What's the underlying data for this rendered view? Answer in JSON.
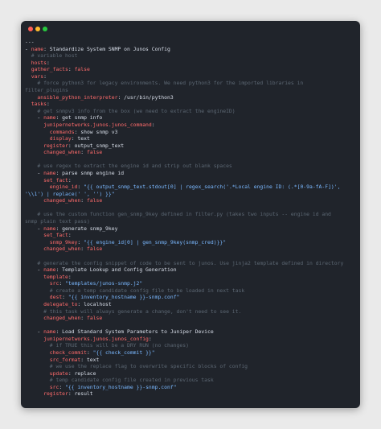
{
  "window": {
    "controls": [
      "close",
      "minimize",
      "maximize"
    ]
  },
  "colors": {
    "background": "#eaeaea",
    "editor_background": "#20242b",
    "key": "#ff6b6b",
    "string": "#7ab8ff",
    "comment": "#5c6773",
    "text": "#d8dee9",
    "close": "#ff5f56",
    "minimize": "#ffbd2e",
    "maximize": "#27c93f"
  },
  "code": {
    "lines": [
      [
        {
          "t": "---",
          "c": "plain"
        }
      ],
      [
        {
          "t": "- ",
          "c": "plain"
        },
        {
          "t": "name",
          "c": "key"
        },
        {
          "t": ": Standardize System SNMP on Junos Config",
          "c": "plain"
        }
      ],
      [
        {
          "t": "  # variable host",
          "c": "comment"
        }
      ],
      [
        {
          "t": "  ",
          "c": "plain"
        },
        {
          "t": "hosts",
          "c": "key"
        },
        {
          "t": ":",
          "c": "plain"
        }
      ],
      [
        {
          "t": "  ",
          "c": "plain"
        },
        {
          "t": "gather_facts",
          "c": "key"
        },
        {
          "t": ": ",
          "c": "plain"
        },
        {
          "t": "false",
          "c": "bool"
        }
      ],
      [
        {
          "t": "  ",
          "c": "plain"
        },
        {
          "t": "vars",
          "c": "key"
        },
        {
          "t": ":",
          "c": "plain"
        }
      ],
      [
        {
          "t": "    # force python3 for legacy environments. We need python3 for the imported libraries in",
          "c": "comment"
        }
      ],
      [
        {
          "t": "filter_plugins",
          "c": "comment"
        }
      ],
      [
        {
          "t": "    ",
          "c": "plain"
        },
        {
          "t": "ansible_python_interpreter",
          "c": "key"
        },
        {
          "t": ": /usr/bin/python3",
          "c": "plain"
        }
      ],
      [
        {
          "t": "  ",
          "c": "plain"
        },
        {
          "t": "tasks",
          "c": "key"
        },
        {
          "t": ":",
          "c": "plain"
        }
      ],
      [
        {
          "t": "    # get snmpv3 info from the box (we need to extract the engineID)",
          "c": "comment"
        }
      ],
      [
        {
          "t": "    - ",
          "c": "plain"
        },
        {
          "t": "name",
          "c": "key"
        },
        {
          "t": ": get snmp info",
          "c": "plain"
        }
      ],
      [
        {
          "t": "      ",
          "c": "plain"
        },
        {
          "t": "junipernetworks.junos.junos_command",
          "c": "key"
        },
        {
          "t": ":",
          "c": "plain"
        }
      ],
      [
        {
          "t": "        ",
          "c": "plain"
        },
        {
          "t": "commands",
          "c": "key"
        },
        {
          "t": ": show snmp v3",
          "c": "plain"
        }
      ],
      [
        {
          "t": "        ",
          "c": "plain"
        },
        {
          "t": "display",
          "c": "key"
        },
        {
          "t": ": text",
          "c": "plain"
        }
      ],
      [
        {
          "t": "      ",
          "c": "plain"
        },
        {
          "t": "register",
          "c": "key"
        },
        {
          "t": ": output_snmp_text",
          "c": "plain"
        }
      ],
      [
        {
          "t": "      ",
          "c": "plain"
        },
        {
          "t": "changed_when",
          "c": "key"
        },
        {
          "t": ": ",
          "c": "plain"
        },
        {
          "t": "false",
          "c": "bool"
        }
      ],
      [
        {
          "t": "",
          "c": "plain"
        }
      ],
      [
        {
          "t": "    # use regex to extract the engine id and strip out blank spaces",
          "c": "comment"
        }
      ],
      [
        {
          "t": "    - ",
          "c": "plain"
        },
        {
          "t": "name",
          "c": "key"
        },
        {
          "t": ": parse snmp engine id",
          "c": "plain"
        }
      ],
      [
        {
          "t": "      ",
          "c": "plain"
        },
        {
          "t": "set_fact",
          "c": "key"
        },
        {
          "t": ":",
          "c": "plain"
        }
      ],
      [
        {
          "t": "        ",
          "c": "plain"
        },
        {
          "t": "engine_id",
          "c": "key"
        },
        {
          "t": ": ",
          "c": "plain"
        },
        {
          "t": "\"{{ output_snmp_text.stdout[0] | regex_search('.*Local engine ID: (.*[0-9a-fA-F])',",
          "c": "str"
        }
      ],
      [
        {
          "t": "'\\\\1') | replace(' ', '') }}\"",
          "c": "str"
        }
      ],
      [
        {
          "t": "      ",
          "c": "plain"
        },
        {
          "t": "changed_when",
          "c": "key"
        },
        {
          "t": ": ",
          "c": "plain"
        },
        {
          "t": "false",
          "c": "bool"
        }
      ],
      [
        {
          "t": "",
          "c": "plain"
        }
      ],
      [
        {
          "t": "    # use the custom function gen_snmp_9key defined in filter.py (takes two inputs -- engine id and",
          "c": "comment"
        }
      ],
      [
        {
          "t": "snmp plain text pass)",
          "c": "comment"
        }
      ],
      [
        {
          "t": "    - ",
          "c": "plain"
        },
        {
          "t": "name",
          "c": "key"
        },
        {
          "t": ": generate snmp_9key",
          "c": "plain"
        }
      ],
      [
        {
          "t": "      ",
          "c": "plain"
        },
        {
          "t": "set_fact",
          "c": "key"
        },
        {
          "t": ":",
          "c": "plain"
        }
      ],
      [
        {
          "t": "        ",
          "c": "plain"
        },
        {
          "t": "snmp_9key",
          "c": "key"
        },
        {
          "t": ": ",
          "c": "plain"
        },
        {
          "t": "\"{{ engine_id[0] | gen_snmp_9key(snmp_cred)}}\"",
          "c": "str"
        }
      ],
      [
        {
          "t": "      ",
          "c": "plain"
        },
        {
          "t": "changed_when",
          "c": "key"
        },
        {
          "t": ": ",
          "c": "plain"
        },
        {
          "t": "false",
          "c": "bool"
        }
      ],
      [
        {
          "t": "",
          "c": "plain"
        }
      ],
      [
        {
          "t": "    # generate the config snippet of code to be sent to junos. Use jinja2 template defined in directory",
          "c": "comment"
        }
      ],
      [
        {
          "t": "    - ",
          "c": "plain"
        },
        {
          "t": "name",
          "c": "key"
        },
        {
          "t": ": Template Lookup and Config Generation",
          "c": "plain"
        }
      ],
      [
        {
          "t": "      ",
          "c": "plain"
        },
        {
          "t": "template",
          "c": "key"
        },
        {
          "t": ":",
          "c": "plain"
        }
      ],
      [
        {
          "t": "        ",
          "c": "plain"
        },
        {
          "t": "src",
          "c": "key"
        },
        {
          "t": ": ",
          "c": "plain"
        },
        {
          "t": "\"templates/junos-snmp.j2\"",
          "c": "str"
        }
      ],
      [
        {
          "t": "        # create a temp candidate config file to be loaded in next task",
          "c": "comment"
        }
      ],
      [
        {
          "t": "        ",
          "c": "plain"
        },
        {
          "t": "dest",
          "c": "key"
        },
        {
          "t": ": ",
          "c": "plain"
        },
        {
          "t": "\"{{ inventory_hostname }}-snmp.conf\"",
          "c": "str"
        }
      ],
      [
        {
          "t": "      ",
          "c": "plain"
        },
        {
          "t": "delegate_to",
          "c": "key"
        },
        {
          "t": ": localhost",
          "c": "plain"
        }
      ],
      [
        {
          "t": "      # this task will always generate a change, don't need to see it.",
          "c": "comment"
        }
      ],
      [
        {
          "t": "      ",
          "c": "plain"
        },
        {
          "t": "changed_when",
          "c": "key"
        },
        {
          "t": ": ",
          "c": "plain"
        },
        {
          "t": "false",
          "c": "bool"
        }
      ],
      [
        {
          "t": "",
          "c": "plain"
        }
      ],
      [
        {
          "t": "    - ",
          "c": "plain"
        },
        {
          "t": "name",
          "c": "key"
        },
        {
          "t": ": Load Standard System Parameters to Juniper Device",
          "c": "plain"
        }
      ],
      [
        {
          "t": "      ",
          "c": "plain"
        },
        {
          "t": "junipernetworks.junos.junos_config",
          "c": "key"
        },
        {
          "t": ":",
          "c": "plain"
        }
      ],
      [
        {
          "t": "        # if TRUE this will be a DRY RUN (no changes)",
          "c": "comment"
        }
      ],
      [
        {
          "t": "        ",
          "c": "plain"
        },
        {
          "t": "check_commit",
          "c": "key"
        },
        {
          "t": ": ",
          "c": "plain"
        },
        {
          "t": "\"{{ check_commit }}\"",
          "c": "str"
        }
      ],
      [
        {
          "t": "        ",
          "c": "plain"
        },
        {
          "t": "src_format",
          "c": "key"
        },
        {
          "t": ": text",
          "c": "plain"
        }
      ],
      [
        {
          "t": "        # we use the replace flag to overwrite specific blocks of config",
          "c": "comment"
        }
      ],
      [
        {
          "t": "        ",
          "c": "plain"
        },
        {
          "t": "update",
          "c": "key"
        },
        {
          "t": ": replace",
          "c": "plain"
        }
      ],
      [
        {
          "t": "        # temp candidate config file created in previous task",
          "c": "comment"
        }
      ],
      [
        {
          "t": "        ",
          "c": "plain"
        },
        {
          "t": "src",
          "c": "key"
        },
        {
          "t": ": ",
          "c": "plain"
        },
        {
          "t": "\"{{ inventory_hostname }}-snmp.conf\"",
          "c": "str"
        }
      ],
      [
        {
          "t": "      ",
          "c": "plain"
        },
        {
          "t": "register",
          "c": "key"
        },
        {
          "t": ": result",
          "c": "plain"
        }
      ]
    ]
  }
}
